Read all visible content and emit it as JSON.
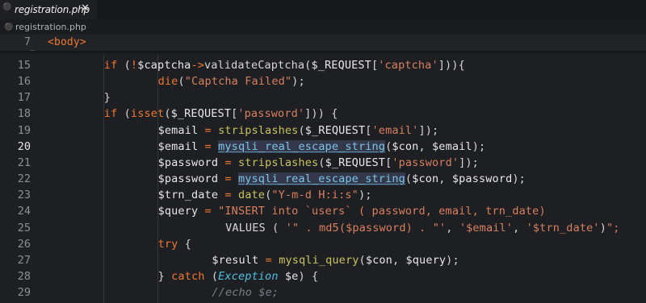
{
  "tab": {
    "icon": "php-file-icon",
    "label": "registration.php",
    "close": "✕"
  },
  "breadcrumb": {
    "icon": "php-file-icon",
    "label": "registration.php"
  },
  "sticky_line": {
    "number": "7",
    "code": "<body>"
  },
  "lines": [
    {
      "n": "15",
      "text": "if (!$captcha->validateCaptcha($_REQUEST['captcha'])){"
    },
    {
      "n": "16",
      "text": "die(\"Captcha Failed\");"
    },
    {
      "n": "17",
      "text": "}"
    },
    {
      "n": "18",
      "text": "if (isset($_REQUEST['password'])) {"
    },
    {
      "n": "19",
      "text": "$email = stripslashes($_REQUEST['email']);"
    },
    {
      "n": "20",
      "text": "$email = mysqli_real_escape_string($con, $email);"
    },
    {
      "n": "21",
      "text": "$password = stripslashes($_REQUEST['password']);"
    },
    {
      "n": "22",
      "text": "$password = mysqli_real_escape_string($con, $password);"
    },
    {
      "n": "23",
      "text": "$trn_date = date(\"Y-m-d H:i:s\");"
    },
    {
      "n": "24",
      "text": "$query = \"INSERT into `users` ( password, email, trn_date)"
    },
    {
      "n": "25",
      "text": "VALUES ( '\" . md5($password) . \"', '$email', '$trn_date')\";"
    },
    {
      "n": "26",
      "text": "try {"
    },
    {
      "n": "27",
      "text": "$result = mysqli_query($con, $query);"
    },
    {
      "n": "28",
      "text": "} catch (Exception $e) {"
    },
    {
      "n": "29",
      "text": "//echo $e;"
    }
  ],
  "colors": {
    "background": "#1e1f22",
    "keyword": "#f07830",
    "function": "#c9c35f",
    "string": "#d98060",
    "class": "#4fc1e0",
    "highlight": "#33384a"
  }
}
